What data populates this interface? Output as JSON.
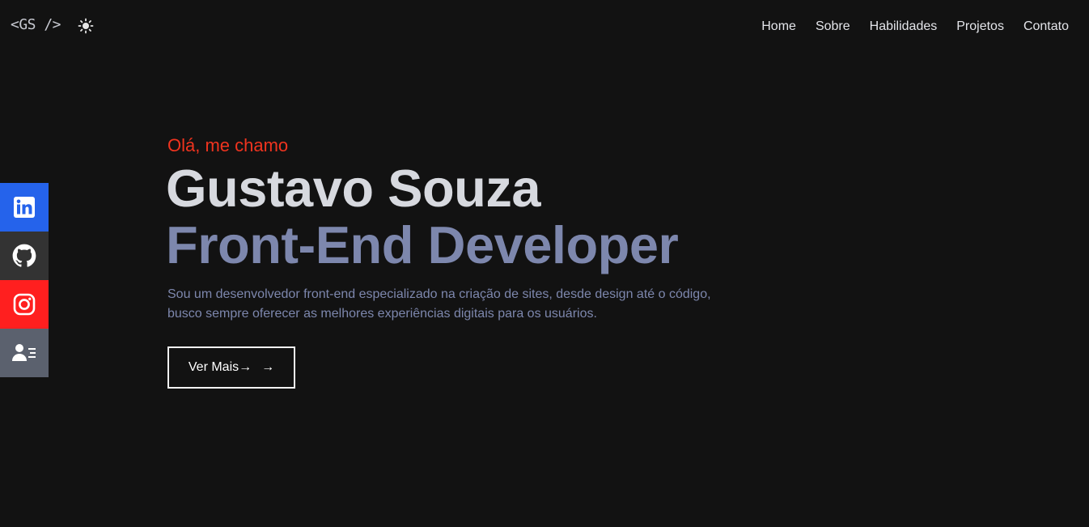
{
  "header": {
    "logo": "<GS />",
    "theme_toggle_icon": "sun-icon",
    "nav": [
      {
        "label": "Home"
      },
      {
        "label": "Sobre"
      },
      {
        "label": "Habilidades"
      },
      {
        "label": "Projetos"
      },
      {
        "label": "Contato"
      }
    ]
  },
  "socials": [
    {
      "icon": "linkedin-icon",
      "color": "#2563eb"
    },
    {
      "icon": "github-icon",
      "color": "#333333"
    },
    {
      "icon": "instagram-icon",
      "color": "#ff1f1f"
    },
    {
      "icon": "contact-card-icon",
      "color": "#5b616e"
    }
  ],
  "hero": {
    "greeting": "Olá, me chamo",
    "name": "Gustavo Souza",
    "role": "Front-End Developer",
    "description_line1": "Sou um desenvolvedor front-end especializado na criação de sites, desde design até o código,",
    "description_line2": "busco sempre oferecer as melhores experiências digitais para os usuários.",
    "cta_label": "Ver Mais→",
    "cta_icon": "→"
  },
  "colors": {
    "background": "#121212",
    "accent_red": "#f0341f",
    "name_text": "#d7d9df",
    "role_text": "#7d87ad"
  }
}
